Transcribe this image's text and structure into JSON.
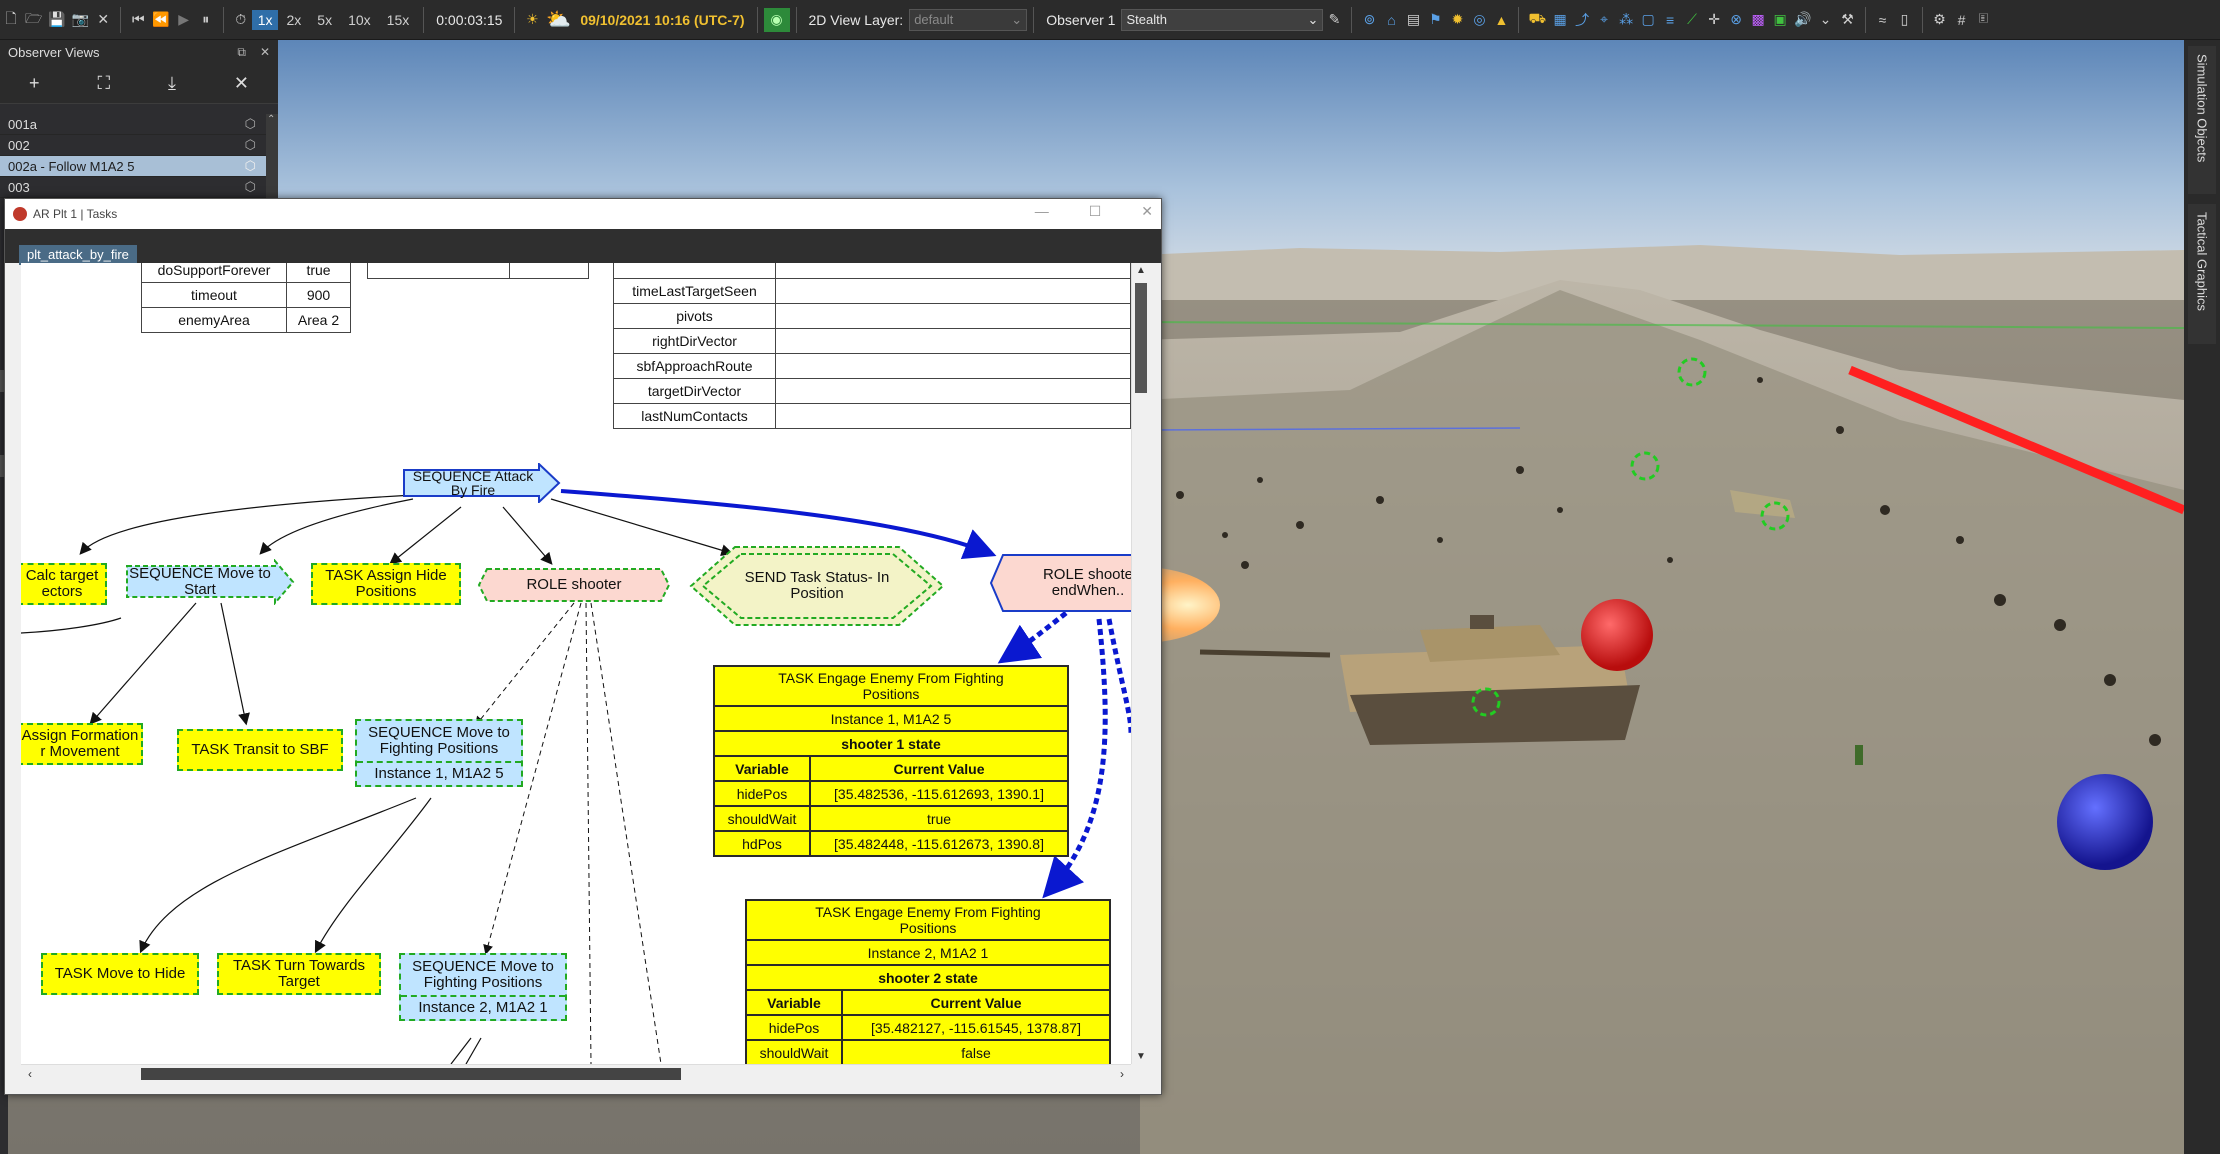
{
  "toolbar": {
    "speeds": [
      "1x",
      "2x",
      "5x",
      "10x",
      "15x"
    ],
    "active_speed": "1x",
    "sim_time": "0:00:03:15",
    "datetime": "09/10/2021 10:16 (UTC-7)",
    "layer_label": "2D View Layer:",
    "layer_value": "default",
    "observer_label": "Observer 1",
    "observer_value": "Stealth"
  },
  "observer_panel": {
    "title": "Observer Views",
    "items": [
      {
        "label": "001a"
      },
      {
        "label": "002"
      },
      {
        "label": "002a  - Follow M1A2 5",
        "selected": true
      },
      {
        "label": "003"
      }
    ]
  },
  "right_tabs": [
    "Simulation Objects",
    "Tactical Graphics"
  ],
  "tasks_window": {
    "title": "AR Plt 1 | Tasks",
    "tab": "plt_attack_by_fire"
  },
  "params_left": [
    {
      "key": "doSupportForever",
      "value": "true"
    },
    {
      "key": "timeout",
      "value": "900"
    },
    {
      "key": "enemyArea",
      "value": "Area 2"
    }
  ],
  "params_right": [
    {
      "key": "timeLastTargetSeen",
      "value": ""
    },
    {
      "key": "pivots",
      "value": ""
    },
    {
      "key": "rightDirVector",
      "value": ""
    },
    {
      "key": "sbfApproachRoute",
      "value": ""
    },
    {
      "key": "targetDirVector",
      "value": ""
    },
    {
      "key": "lastNumContacts",
      "value": ""
    }
  ],
  "nodes": {
    "seq_attack": "SEQUENCE Attack By Fire",
    "calc_target": "Calc target ectors",
    "seq_move_start": "SEQUENCE Move to Start",
    "task_hide_positions": "TASK Assign Hide Positions",
    "role_shooter": "ROLE shooter",
    "send_status": "SEND Task Status- In Position",
    "role_shooter_end": "ROLE shoote endWhen..",
    "assign_formation": "Assign Formation r Movement",
    "transit_sbf": "TASK Transit to SBF",
    "seq_move_fight_1": "SEQUENCE Move to Fighting Positions",
    "seq_move_fight_1_inst": "Instance 1, M1A2 5",
    "move_to_hide": "TASK Move to Hide",
    "turn_target": "TASK Turn Towards Target",
    "seq_move_fight_2": "SEQUENCE Move to Fighting Positions",
    "seq_move_fight_2_inst": "Instance 2, M1A2 1"
  },
  "engage_1": {
    "title": "TASK Engage Enemy From Fighting Positions",
    "instance": "Instance 1, M1A2 5",
    "state": "shooter 1 state",
    "col_variable": "Variable",
    "col_value": "Current Value",
    "rows": [
      {
        "var": "hidePos",
        "val": "[35.482536, -115.612693, 1390.1]"
      },
      {
        "var": "shouldWait",
        "val": "true"
      },
      {
        "var": "hdPos",
        "val": "[35.482448, -115.612673, 1390.8]"
      }
    ]
  },
  "engage_2": {
    "title": "TASK Engage Enemy From Fighting Positions",
    "instance": "Instance 2, M1A2 1",
    "state": "shooter 2 state",
    "col_variable": "Variable",
    "col_value": "Current Value",
    "rows": [
      {
        "var": "hidePos",
        "val": "[35.482127, -115.61545, 1378.87]"
      },
      {
        "var": "shouldWait",
        "val": "false"
      }
    ]
  },
  "colors": {
    "accent": "#2f6ea8",
    "node_yellow": "#ffff00",
    "node_blue": "#bfe4ff",
    "node_pink": "#fcd8d0",
    "node_border": "#22aa22",
    "edge_blue": "#0a18d0"
  },
  "icons": [
    "new-icon",
    "open-icon",
    "save-icon",
    "screenshot-icon",
    "close-icon",
    "skip-start-icon",
    "step-back-icon",
    "play-icon",
    "pause-icon",
    "clock-icon",
    "sun-icon",
    "weather-icon",
    "globe-icon",
    "map-icon",
    "grid-icon",
    "settings-icon"
  ]
}
